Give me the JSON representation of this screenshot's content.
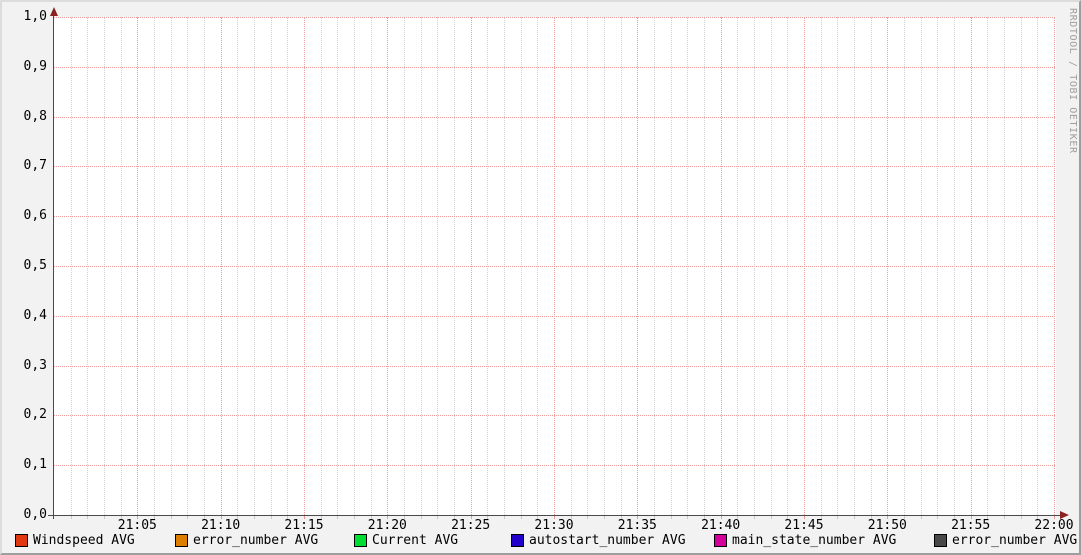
{
  "watermark": "RRDTOOL / TOBI OETIKER",
  "chart_data": {
    "type": "line",
    "title": "",
    "xlabel": "",
    "ylabel": "",
    "ylim": [
      0.0,
      1.0
    ],
    "y_tick_step": 0.1,
    "y_tick_labels": [
      "1,0",
      "0,9",
      "0,8",
      "0,7",
      "0,6",
      "0,5",
      "0,4",
      "0,3",
      "0,2",
      "0,1",
      "0,0"
    ],
    "x_tick_labels": [
      "21:05",
      "21:10",
      "21:15",
      "21:20",
      "21:25",
      "21:30",
      "21:35",
      "21:40",
      "21:45",
      "21:50",
      "21:55",
      "22:00"
    ],
    "x_minor_per_major": 5,
    "grid": "dotted",
    "legend_position": "bottom",
    "no_data": true,
    "series": [
      {
        "name": "Windspeed AVG",
        "color": "#e23812",
        "values": []
      },
      {
        "name": "error_number AVG",
        "color": "#dd7e00",
        "values": []
      },
      {
        "name": "Current AVG",
        "color": "#00dd33",
        "values": []
      },
      {
        "name": "autostart_number AVG",
        "color": "#2200cc",
        "values": []
      },
      {
        "name": "main_state_number AVG",
        "color": "#d4009c",
        "values": []
      },
      {
        "name": "error_number AVG",
        "color": "#484848",
        "values": []
      }
    ],
    "legend_x_offsets": [
      13,
      173,
      352,
      509,
      712,
      932
    ]
  },
  "colors": {
    "background": "#f2f2f2",
    "canvas": "#ffffff",
    "major_grid": "#ec9a9a",
    "minor_grid": "#d2d2d2",
    "axis": "#4a4a4a",
    "arrow": "#8b2222",
    "watermark_text": "#9e9e9e"
  }
}
